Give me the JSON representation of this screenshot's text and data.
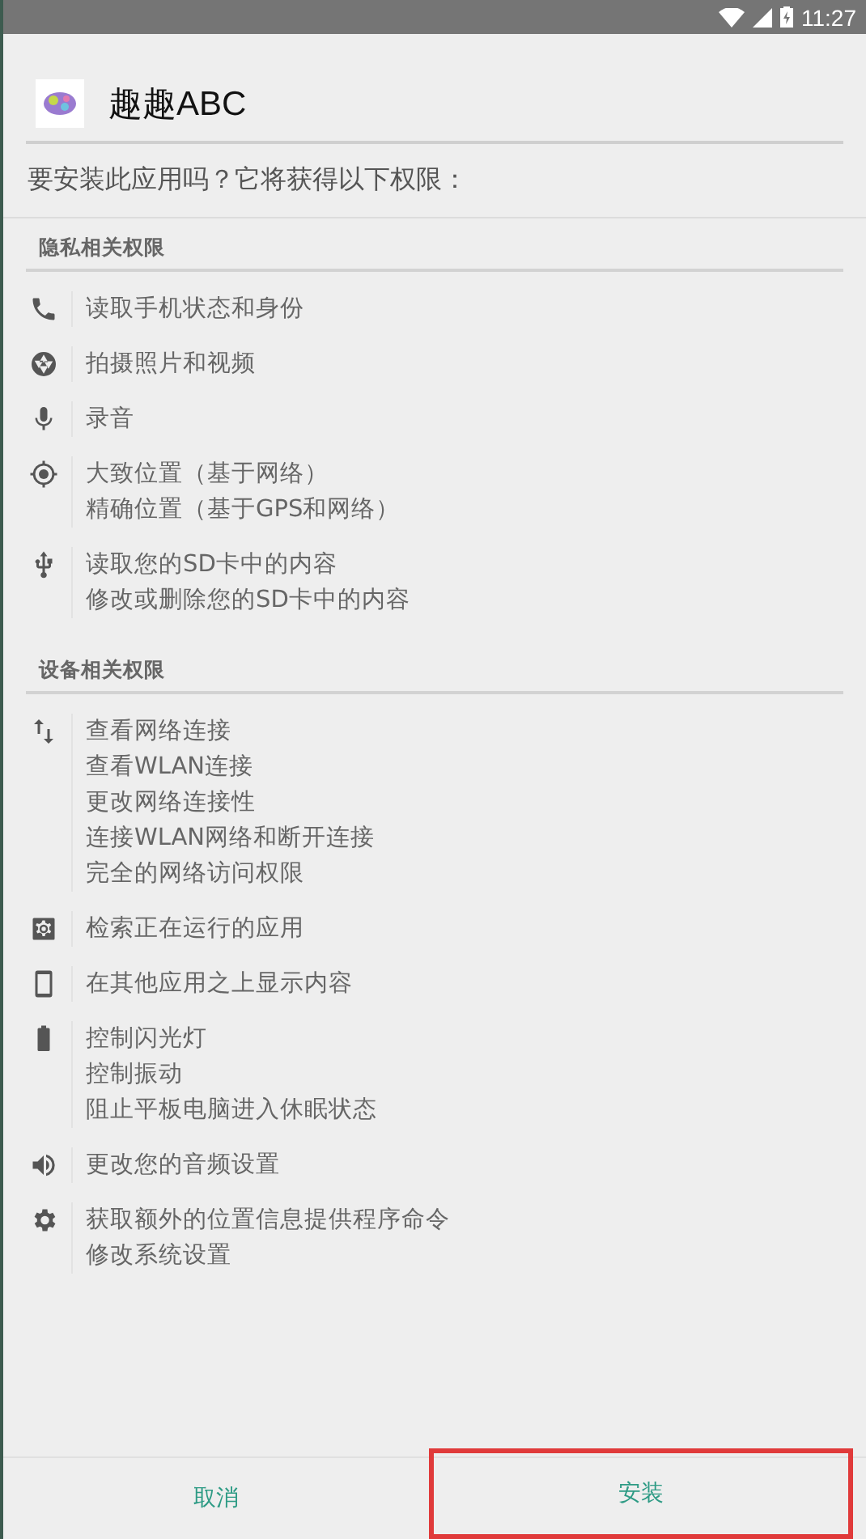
{
  "status_bar": {
    "time": "11:27"
  },
  "app": {
    "name": "趣趣ABC"
  },
  "prompt": "要安装此应用吗？它将获得以下权限：",
  "sections": [
    {
      "title": "隐私相关权限",
      "groups": [
        {
          "kind": "phone",
          "lines": [
            "读取手机状态和身份"
          ]
        },
        {
          "kind": "camera",
          "lines": [
            "拍摄照片和视频"
          ]
        },
        {
          "kind": "mic",
          "lines": [
            "录音"
          ]
        },
        {
          "kind": "location",
          "lines": [
            "大致位置（基于网络）",
            "精确位置（基于GPS和网络）"
          ]
        },
        {
          "kind": "usb",
          "lines": [
            "读取您的SD卡中的内容",
            "修改或删除您的SD卡中的内容"
          ]
        }
      ]
    },
    {
      "title": "设备相关权限",
      "groups": [
        {
          "kind": "network",
          "lines": [
            "查看网络连接",
            "查看WLAN连接",
            "更改网络连接性",
            "连接WLAN网络和断开连接",
            "完全的网络访问权限"
          ]
        },
        {
          "kind": "apps",
          "lines": [
            "检索正在运行的应用"
          ]
        },
        {
          "kind": "device",
          "lines": [
            "在其他应用之上显示内容"
          ]
        },
        {
          "kind": "battery",
          "lines": [
            "控制闪光灯",
            "控制振动",
            "阻止平板电脑进入休眠状态"
          ]
        },
        {
          "kind": "volume",
          "lines": [
            "更改您的音频设置"
          ]
        },
        {
          "kind": "settings",
          "lines": [
            "获取额外的位置信息提供程序命令",
            "修改系统设置"
          ]
        }
      ]
    }
  ],
  "buttons": [
    {
      "label": "取消",
      "highlighted": false
    },
    {
      "label": "安装",
      "highlighted": true
    }
  ]
}
